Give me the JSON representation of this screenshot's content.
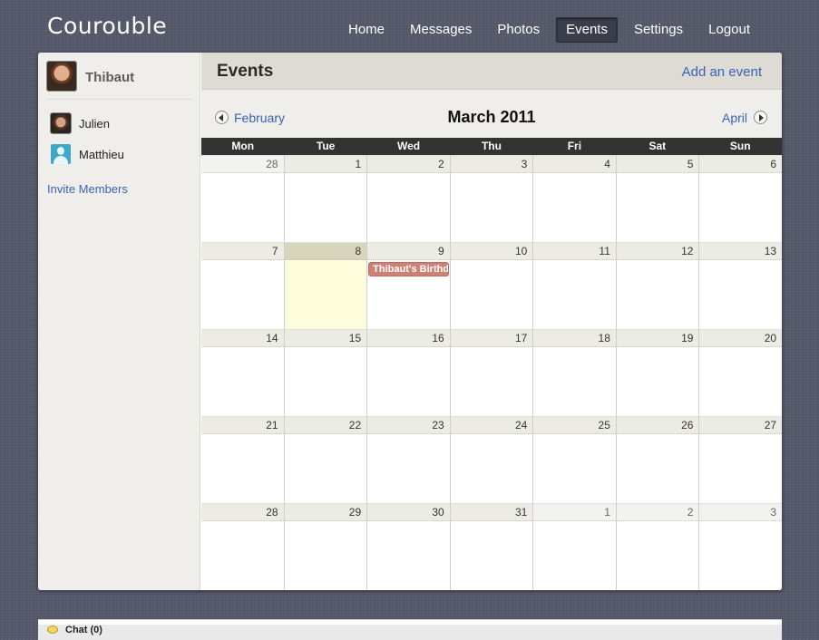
{
  "app": {
    "title": "Courouble"
  },
  "nav": {
    "items": [
      {
        "label": "Home"
      },
      {
        "label": "Messages"
      },
      {
        "label": "Photos"
      },
      {
        "label": "Events",
        "active": true
      },
      {
        "label": "Settings"
      },
      {
        "label": "Logout"
      }
    ]
  },
  "sidebar": {
    "profile": {
      "name": "Thibaut"
    },
    "members": [
      {
        "name": "Julien",
        "avatar": "photo"
      },
      {
        "name": "Matthieu",
        "avatar": "default-user-icon"
      }
    ],
    "invite_label": "Invite Members"
  },
  "events_page": {
    "title": "Events",
    "add_label": "Add an event"
  },
  "calendar": {
    "prev_label": "February",
    "next_label": "April",
    "month_title": "March 2011",
    "weekdays": [
      "Mon",
      "Tue",
      "Wed",
      "Thu",
      "Fri",
      "Sat",
      "Sun"
    ],
    "weeks": [
      [
        "28",
        "1",
        "2",
        "3",
        "4",
        "5",
        "6"
      ],
      [
        "7",
        "8",
        "9",
        "10",
        "11",
        "12",
        "13"
      ],
      [
        "14",
        "15",
        "16",
        "17",
        "18",
        "19",
        "20"
      ],
      [
        "21",
        "22",
        "23",
        "24",
        "25",
        "26",
        "27"
      ],
      [
        "28",
        "29",
        "30",
        "31",
        "1",
        "2",
        "3"
      ]
    ],
    "today": "8",
    "events": [
      {
        "day": "9",
        "title": "Thibaut's Birthday",
        "color": "#cf8075"
      }
    ]
  },
  "chat": {
    "label": "Chat (0)"
  }
}
